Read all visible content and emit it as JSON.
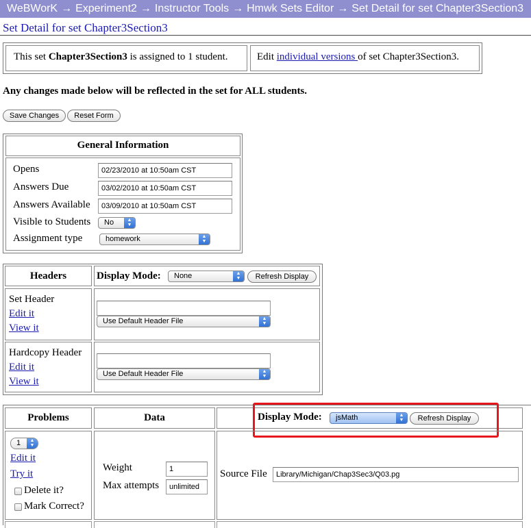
{
  "breadcrumb": {
    "items": [
      "WeBWorK",
      "Experiment2",
      "Instructor Tools",
      "Hmwk Sets Editor",
      "Set Detail for set Chapter3Section3"
    ],
    "separator": "→"
  },
  "page_title": "Set Detail for set Chapter3Section3",
  "assignment_info": {
    "prefix": "This set ",
    "set_name": "Chapter3Section3",
    "suffix": " is assigned to 1 student.",
    "edit_prefix": "Edit ",
    "edit_link": "individual versions ",
    "edit_suffix": "of set Chapter3Section3."
  },
  "warning": "Any changes made below will be reflected in the set for ALL students.",
  "form_buttons": {
    "save": "Save Changes",
    "reset": "Reset Form"
  },
  "general_info": {
    "title": "General Information",
    "fields": [
      {
        "label": "Opens",
        "value": "02/23/2010 at 10:50am CST"
      },
      {
        "label": "Answers Due",
        "value": "03/02/2010 at 10:50am CST"
      },
      {
        "label": "Answers Available",
        "value": "03/09/2010 at 10:50am CST"
      }
    ],
    "visible_label": "Visible to Students",
    "visible_value": "No",
    "type_label": "Assignment type",
    "type_value": "homework"
  },
  "headers_section": {
    "title": "Headers",
    "display_mode_label": "Display Mode:",
    "display_mode_value": "None",
    "refresh": "Refresh Display",
    "rows": [
      {
        "name": "Set Header",
        "edit": "Edit it",
        "view": "View it",
        "input": "",
        "select": "Use Default Header File"
      },
      {
        "name": "Hardcopy Header",
        "edit": "Edit it",
        "view": "View it",
        "input": "",
        "select": "Use Default Header File"
      }
    ]
  },
  "problems_section": {
    "title": "Problems",
    "data_title": "Data",
    "display_mode_label": "Display Mode:",
    "display_mode_value": "jsMath",
    "refresh": "Refresh Display",
    "problem": {
      "number": "1",
      "edit": "Edit it",
      "try": "Try it",
      "delete": "Delete it?",
      "mark": "Mark Correct?",
      "weight_label": "Weight",
      "weight_value": "1",
      "attempts_label": "Max attempts",
      "attempts_value": "unlimited",
      "source_label": "Source File",
      "source_value": "Library/Michigan/Chap3Sec3/Q03.pg"
    }
  },
  "colors": {
    "breadcrumb_bg": "#8f8fd0",
    "link": "#1a1ab0",
    "highlight": "#e8151b"
  }
}
